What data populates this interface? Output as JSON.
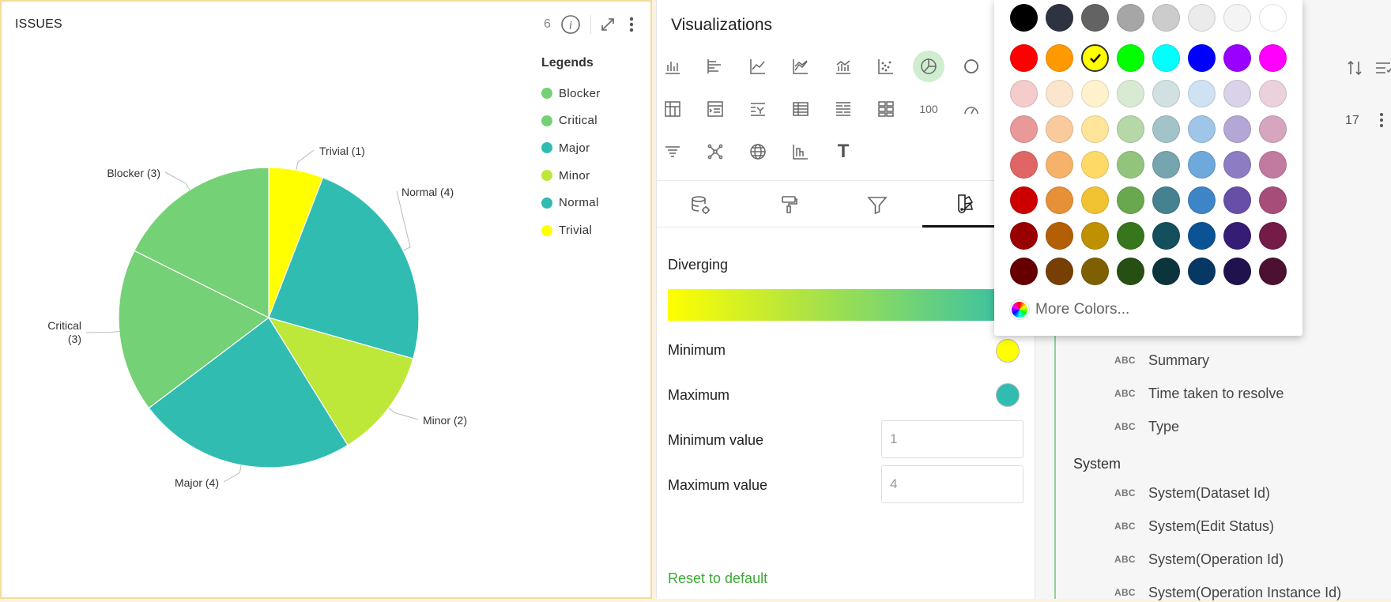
{
  "widget": {
    "title": "ISSUES",
    "count": "6",
    "legend_title": "Legends",
    "icons": [
      "info-icon",
      "expand-icon",
      "more-vert-icon"
    ]
  },
  "chart_data": {
    "type": "pie",
    "categories": [
      "Blocker",
      "Critical",
      "Major",
      "Minor",
      "Normal",
      "Trivial"
    ],
    "values": [
      3,
      3,
      4,
      2,
      4,
      1
    ],
    "colors": [
      "#74d175",
      "#74d175",
      "#31bcb1",
      "#bde839",
      "#31bcb1",
      "#ffff00"
    ],
    "slice_labels": {
      "Blocker": "Blocker (3)",
      "Critical": "Critical\n(3)",
      "Major": "Major (4)",
      "Minor": "Minor (2)",
      "Normal": "Normal (4)",
      "Trivial": "Trivial (1)"
    },
    "legend_placement": "top-right"
  },
  "viz_panel": {
    "title": "Visualizations",
    "chart_types": [
      "bar-chart-icon",
      "horizontal-bar-icon",
      "line-chart-icon",
      "area-chart-icon",
      "combo-chart-icon",
      "scatter-chart-icon",
      "pie-chart-icon",
      "donut-chart-icon",
      "pivot-icon",
      "drill-table-icon",
      "filter-list-icon",
      "table-icon",
      "grouped-list-icon",
      "tile-grid-icon",
      "kpi-number-icon",
      "gauge-icon",
      "funnel-icon",
      "network-icon",
      "globe-icon",
      "histogram-icon",
      "text-icon"
    ],
    "kpi_label": "100",
    "text_label": "T",
    "tabs": [
      "data-source-icon",
      "format-brush-icon",
      "filter-icon",
      "color-palette-icon"
    ],
    "diverging_label": "Diverging",
    "minimum_label": "Minimum",
    "maximum_label": "Maximum",
    "minimum_value_label": "Minimum value",
    "maximum_value_label": "Maximum value",
    "minimum_value": "1",
    "maximum_value": "4",
    "minimum_color": "#ffff00",
    "maximum_color": "#31bcb1",
    "reset_label": "Reset to default"
  },
  "fields_panel": {
    "count": "17",
    "abc_badge": "ABC",
    "section_system": "System",
    "fields": [
      "Summary",
      "Time taken to resolve",
      "Type"
    ],
    "system_fields": [
      "System(Dataset Id)",
      "System(Edit Status)",
      "System(Operation Id)",
      "System(Operation Instance Id)"
    ]
  },
  "color_picker": {
    "more_colors_label": "More Colors...",
    "selected": "#ffff00",
    "rows": [
      [
        "#000000",
        "#2d3340",
        "#636363",
        "#a6a6a6",
        "#cccccc",
        "#ebebeb",
        "#f4f4f4",
        "#ffffff"
      ],
      [
        "#ff0000",
        "#ff9900",
        "#ffff00",
        "#00ff00",
        "#00ffff",
        "#0000ff",
        "#9900ff",
        "#ff00ff"
      ],
      [
        "#f4cccc",
        "#fce5cd",
        "#fff2cc",
        "#d9ead3",
        "#d0e0e3",
        "#cfe2f3",
        "#d9d2e9",
        "#ead1dc"
      ],
      [
        "#ea9999",
        "#f9cb9c",
        "#ffe599",
        "#b6d7a8",
        "#a2c4c9",
        "#9fc5e8",
        "#b4a7d6",
        "#d5a6bd"
      ],
      [
        "#e06666",
        "#f6b26b",
        "#ffd966",
        "#93c47d",
        "#76a5af",
        "#6fa8dc",
        "#8e7cc3",
        "#c27ba0"
      ],
      [
        "#cc0000",
        "#e69138",
        "#f1c232",
        "#6aa84f",
        "#45818e",
        "#3d85c6",
        "#674ea7",
        "#a64d79"
      ],
      [
        "#990000",
        "#b45f06",
        "#bf9000",
        "#38761d",
        "#134f5c",
        "#0b5394",
        "#351c75",
        "#741b47"
      ],
      [
        "#660000",
        "#783f04",
        "#7f6000",
        "#274e13",
        "#0c343d",
        "#073763",
        "#20124d",
        "#4c1130"
      ]
    ]
  }
}
